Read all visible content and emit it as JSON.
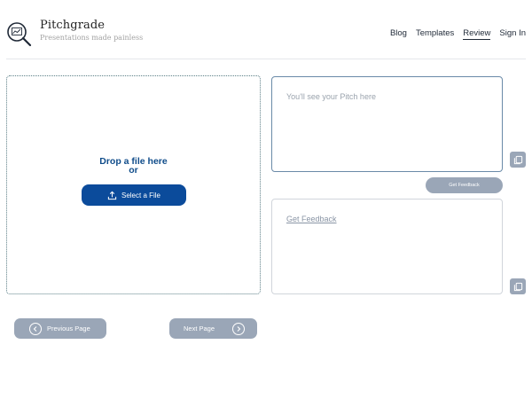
{
  "header": {
    "brand": "Pitchgrade",
    "tagline": "Presentations made painless",
    "logo_icon": "magnifier-chart-icon",
    "nav": [
      {
        "label": "Blog",
        "active": false
      },
      {
        "label": "Templates",
        "active": false
      },
      {
        "label": "Review",
        "active": true
      },
      {
        "label": "Sign In",
        "active": false
      }
    ]
  },
  "upload": {
    "drop_text": "Drop a file here",
    "or_text": "or",
    "select_button": "Select a File",
    "select_icon": "upload-icon"
  },
  "pitch": {
    "placeholder": "You'll see your Pitch here",
    "copy_icon": "copy-icon"
  },
  "feedback": {
    "button_label": "Get Feedback",
    "link_label": "Get Feedback",
    "copy_icon": "copy-icon"
  },
  "pagination": {
    "previous_label": "Previous Page",
    "next_label": "Next Page",
    "previous_icon": "chevron-left-icon",
    "next_icon": "chevron-right-icon"
  },
  "colors": {
    "primary": "#0b4b9b",
    "disabled": "#9aa6b7",
    "accent_text": "#0f4c8a"
  }
}
